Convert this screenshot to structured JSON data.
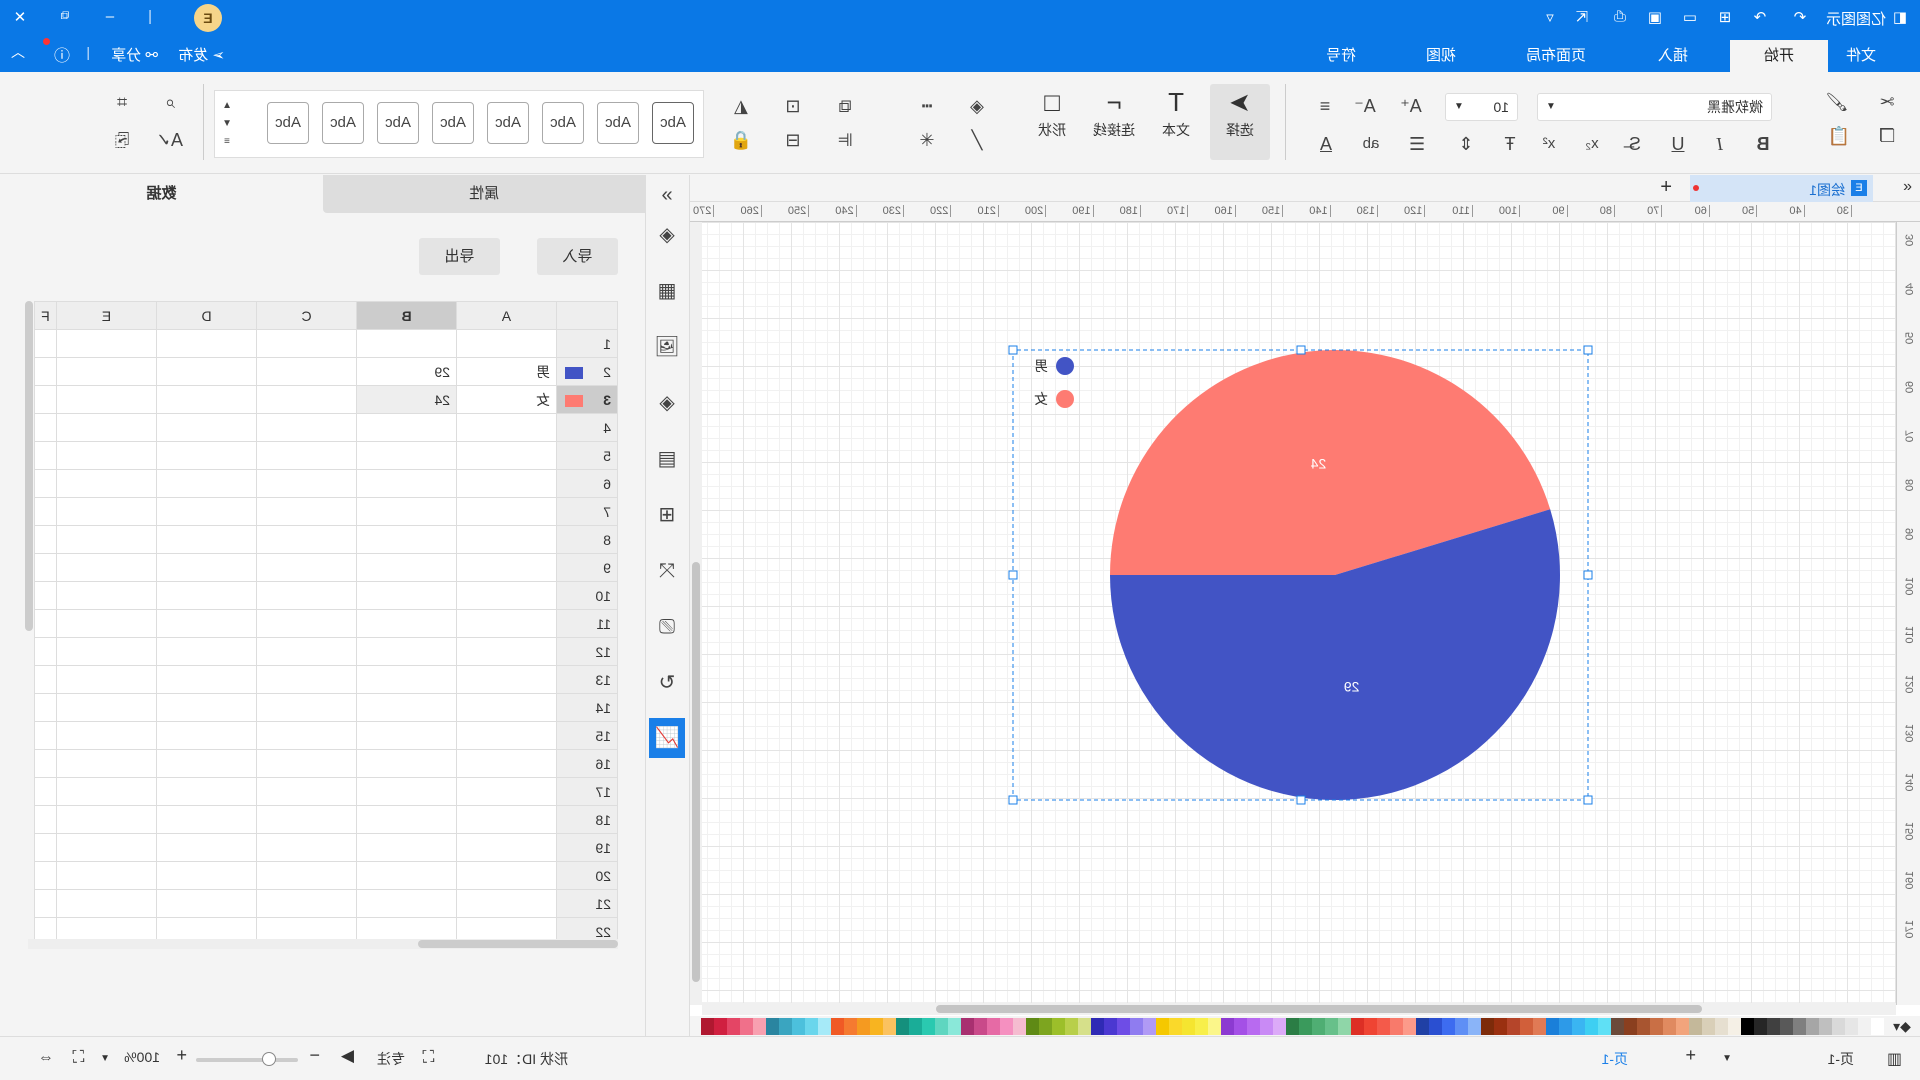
{
  "app": {
    "title": "亿图图示",
    "logo_letter": "E"
  },
  "menu": {
    "tabs": [
      "文件",
      "开始",
      "插入",
      "页面布局",
      "视图",
      "符号"
    ],
    "active": "开始",
    "publish": "发布",
    "share": "分享"
  },
  "ribbon": {
    "font_name": "微软雅黑",
    "font_size": "10",
    "select": "选择",
    "text": "文本",
    "connector": "连接线",
    "shape": "形状",
    "style_sample": "Abc",
    "bold": "B",
    "italic": "I",
    "underline": "U"
  },
  "doc_tab": {
    "name": "绘图1"
  },
  "rulers": {
    "h": [
      "30",
      "40",
      "50",
      "60",
      "70",
      "80",
      "90",
      "100",
      "110",
      "120",
      "130",
      "140",
      "150",
      "160",
      "170",
      "180",
      "190",
      "200",
      "210",
      "220",
      "230",
      "240",
      "250",
      "260",
      "270"
    ],
    "v": [
      "30",
      "40",
      "50",
      "60",
      "70",
      "80",
      "90",
      "100",
      "110",
      "120",
      "130",
      "140",
      "150",
      "160",
      "170"
    ]
  },
  "chart_data": {
    "type": "pie",
    "categories": [
      "男",
      "女"
    ],
    "values": [
      29,
      24
    ],
    "colors": [
      "#4254c5",
      "#fe7b72"
    ],
    "data_labels": [
      "29",
      "24"
    ],
    "legend": "top-left"
  },
  "panel": {
    "tabs": [
      "属性",
      "数据"
    ],
    "active": "数据",
    "import": "导入",
    "export": "导出",
    "columns": [
      "A",
      "B",
      "C",
      "D",
      "E",
      "F"
    ],
    "rows": [
      [
        "1",
        "",
        "",
        ""
      ],
      [
        "2",
        "#4254c5",
        "男",
        "29"
      ],
      [
        "3",
        "#fe7b72",
        "女",
        "24"
      ],
      [
        "4"
      ],
      [
        "5"
      ],
      [
        "6"
      ],
      [
        "7"
      ],
      [
        "8"
      ],
      [
        "9"
      ],
      [
        "10"
      ],
      [
        "11"
      ],
      [
        "12"
      ],
      [
        "13"
      ],
      [
        "14"
      ],
      [
        "15"
      ],
      [
        "16"
      ],
      [
        "17"
      ],
      [
        "18"
      ],
      [
        "19"
      ],
      [
        "20"
      ],
      [
        "21"
      ],
      [
        "22"
      ]
    ]
  },
  "palette": [
    "#ffffff",
    "#f2f2f2",
    "#e6e6e6",
    "#d9d9d9",
    "#bfbfbf",
    "#a6a6a6",
    "#7f7f7f",
    "#595959",
    "#404040",
    "#262626",
    "#000000",
    "#f5f0e6",
    "#e6dfd0",
    "#d9cfb8",
    "#c4b89a",
    "#f2a47c",
    "#e08a60",
    "#c96f45",
    "#a85530",
    "#8a3f1f",
    "#6b4a3a",
    "#5fe0f5",
    "#3ecff2",
    "#3ab5f2",
    "#2d9ae8",
    "#1a7fd9",
    "#e07a55",
    "#d15f3a",
    "#b5452a",
    "#9a3010",
    "#7d2b0a",
    "#8ab4f8",
    "#5f8ff5",
    "#3d6cf0",
    "#2a4fd1",
    "#2040a5",
    "#fc9a8a",
    "#f87a6b",
    "#f45a4a",
    "#ef4433",
    "#dd2f25",
    "#8fd6a8",
    "#67c08a",
    "#4fae73",
    "#3a9a5c",
    "#2b7d45",
    "#dcaaf8",
    "#c98af5",
    "#b86af0",
    "#a450e6",
    "#8c3ad1",
    "#fbf68a",
    "#f8ef4a",
    "#f5e530",
    "#fad92a",
    "#f5c800",
    "#b09af5",
    "#8f7cf0",
    "#6e4de6",
    "#4b38d1",
    "#2f2ab5",
    "#d6e08a",
    "#b8cf4a",
    "#9cbf2a",
    "#7da51f",
    "#5f8a15",
    "#f5bcd0",
    "#f590c0",
    "#e66aa5",
    "#c94a8a",
    "#a83070",
    "#8ae8d9",
    "#5fd6c0",
    "#2ac9b0",
    "#1aad98",
    "#15907d",
    "#fbc25f",
    "#f8b420",
    "#f59a20",
    "#f57a30",
    "#f05a25",
    "#a6eaf8",
    "#6ad6ec",
    "#4cc0dc",
    "#3aa5c0",
    "#2a85a0",
    "#f8a0b0",
    "#f0708a",
    "#e44565",
    "#d02040",
    "#b01830"
  ],
  "status": {
    "page": "页-1",
    "active_page": "页-1",
    "shape_id": "形状 ID：101",
    "focus": "专注",
    "zoom": "100%"
  }
}
